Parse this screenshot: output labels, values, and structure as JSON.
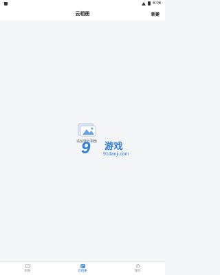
{
  "status_bar": {
    "left_icon": "notification-icon",
    "time": "6:06",
    "wifi_icon": "wifi-icon",
    "battery_icon": "battery-icon"
  },
  "header": {
    "title": "云相册",
    "action_label": "新建"
  },
  "empty_state": {
    "text": "请创建云相册",
    "icon": "photo-album-icon"
  },
  "watermark": {
    "logo_mark": "9",
    "text_cn": "游戏",
    "url": "91danji.com"
  },
  "tabs": [
    {
      "label": "相册",
      "icon": "photo-icon",
      "active": false
    },
    {
      "label": "云相册",
      "icon": "cloud-album-icon",
      "active": true
    },
    {
      "label": "我的",
      "icon": "profile-icon",
      "active": false
    }
  ],
  "colors": {
    "accent": "#2f7de1",
    "background": "#f4f5f7",
    "bar": "#ffffff"
  }
}
